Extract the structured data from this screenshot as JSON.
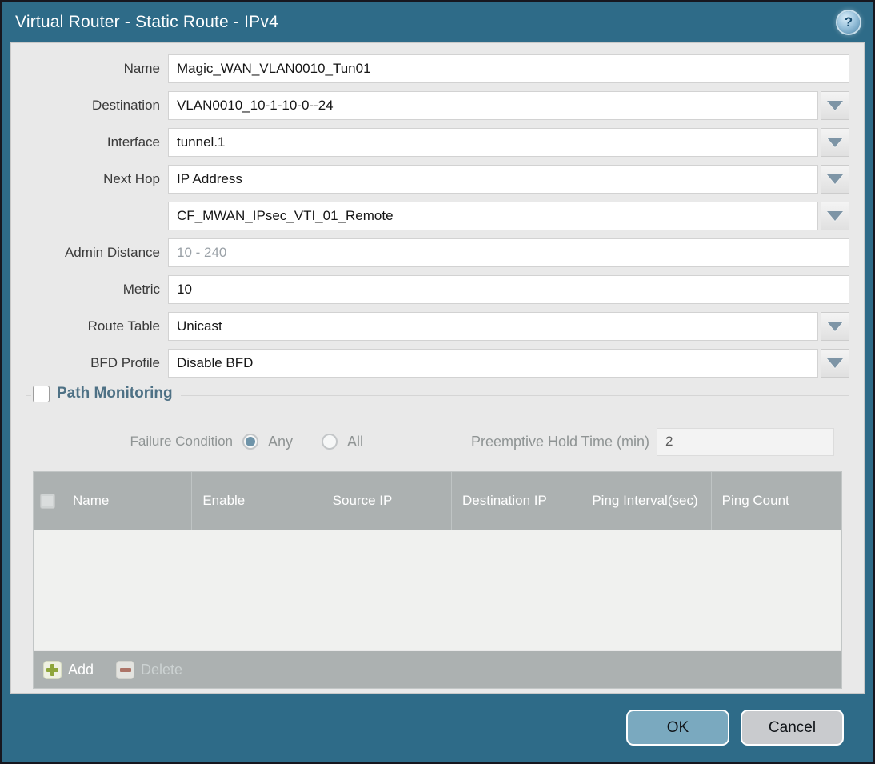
{
  "window": {
    "title": "Virtual Router - Static Route - IPv4",
    "help_glyph": "?"
  },
  "form": {
    "fields": [
      {
        "label": "Name",
        "value": "Magic_WAN_VLAN0010_Tun01",
        "type": "text"
      },
      {
        "label": "Destination",
        "value": "VLAN0010_10-1-10-0--24",
        "type": "dropdown"
      },
      {
        "label": "Interface",
        "value": "tunnel.1",
        "type": "dropdown"
      },
      {
        "label": "Next Hop",
        "value": "IP Address",
        "type": "dropdown"
      },
      {
        "label": "",
        "value": "CF_MWAN_IPsec_VTI_01_Remote",
        "type": "dropdown"
      },
      {
        "label": "Admin Distance",
        "value": "",
        "placeholder": "10 - 240",
        "type": "text"
      },
      {
        "label": "Metric",
        "value": "10",
        "type": "text"
      },
      {
        "label": "Route Table",
        "value": "Unicast",
        "type": "dropdown"
      },
      {
        "label": "BFD Profile",
        "value": "Disable BFD",
        "type": "dropdown"
      }
    ]
  },
  "path_monitoring": {
    "title": "Path Monitoring",
    "checkbox_checked": false,
    "failure_condition_label": "Failure Condition",
    "options": {
      "any": "Any",
      "all": "All"
    },
    "selected_option": "Any",
    "preemptive_label": "Preemptive Hold Time (min)",
    "preemptive_value": "2",
    "table": {
      "columns": [
        "Name",
        "Enable",
        "Source IP",
        "Destination IP",
        "Ping Interval(sec)",
        "Ping Count"
      ],
      "rows": []
    },
    "add_label": "Add",
    "delete_label": "Delete"
  },
  "footer": {
    "ok_label": "OK",
    "cancel_label": "Cancel"
  },
  "colors": {
    "chrome_teal": "#2e6b88",
    "content_bg": "#e9e9e9",
    "table_header_gray": "#acb1b1",
    "ok_button_blue": "#7aa9bf",
    "cancel_button_gray": "#c9cbce",
    "pm_title_slate": "#4e7185",
    "radio_selected": "#6f94a9",
    "add_icon_green": "#8fa63c",
    "delete_icon_red": "#ad7467"
  }
}
